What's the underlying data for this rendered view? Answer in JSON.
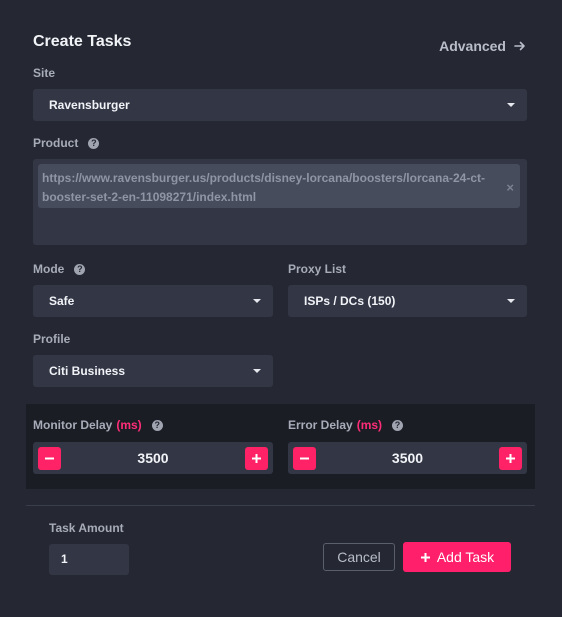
{
  "header": {
    "title": "Create Tasks",
    "advanced_label": "Advanced"
  },
  "site": {
    "label": "Site",
    "value": "Ravensburger"
  },
  "product": {
    "label": "Product",
    "url": "https://www.ravensburger.us/products/disney-lorcana/boosters/lorcana-24-ct-booster-set-2-en-11098271/index.html",
    "remove_glyph": "×"
  },
  "mode": {
    "label": "Mode",
    "value": "Safe"
  },
  "proxy": {
    "label": "Proxy List",
    "value": "ISPs / DCs (150)"
  },
  "profile": {
    "label": "Profile",
    "value": "Citi Business"
  },
  "monitor_delay": {
    "label": "Monitor Delay",
    "unit": "(ms)",
    "value": "3500"
  },
  "error_delay": {
    "label": "Error Delay",
    "unit": "(ms)",
    "value": "3500"
  },
  "task_amount": {
    "label": "Task Amount",
    "value": "1"
  },
  "actions": {
    "cancel_label": "Cancel",
    "add_label": "Add Task"
  },
  "help_glyph": "?",
  "colors": {
    "accent": "#ff1f6a",
    "background": "#252833",
    "input": "#323645"
  }
}
